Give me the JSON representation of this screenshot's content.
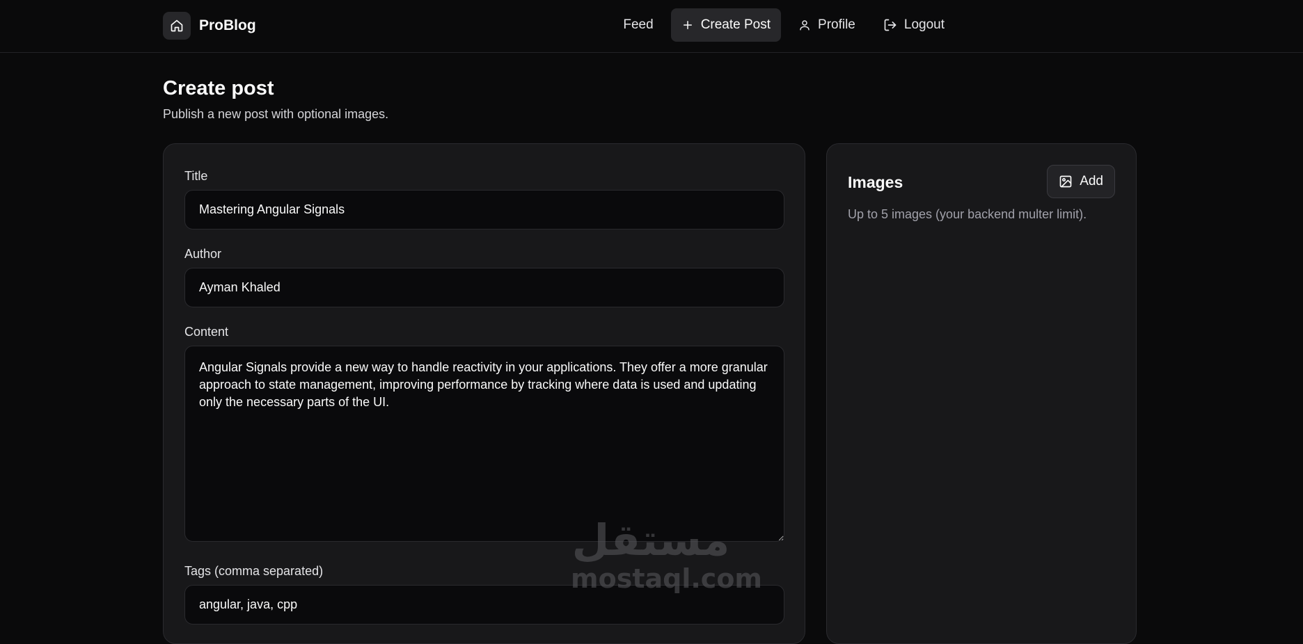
{
  "header": {
    "brand": "ProBlog",
    "brand_icon": "home-icon",
    "nav": {
      "feed": "Feed",
      "create_post": "Create Post",
      "profile": "Profile",
      "logout": "Logout"
    }
  },
  "page": {
    "title": "Create post",
    "subtitle": "Publish a new post with optional images."
  },
  "form": {
    "title_label": "Title",
    "title_value": "Mastering Angular Signals",
    "author_label": "Author",
    "author_value": "Ayman Khaled",
    "content_label": "Content",
    "content_value": "Angular Signals provide a new way to handle reactivity in your applications. They offer a more granular approach to state management, improving performance by tracking where data is used and updating only the necessary parts of the UI.",
    "tags_label": "Tags (comma separated)",
    "tags_value": "angular, java, cpp"
  },
  "images": {
    "title": "Images",
    "add_label": "Add",
    "note": "Up to 5 images (your backend multer limit)."
  },
  "watermark": {
    "arabic": "مستقل",
    "latin": "mostaql.com"
  },
  "colors": {
    "background": "#0a0a0b",
    "card": "#18181a",
    "input": "#0a0a0c",
    "border": "#2a2a2e",
    "active_nav": "#27272a"
  }
}
